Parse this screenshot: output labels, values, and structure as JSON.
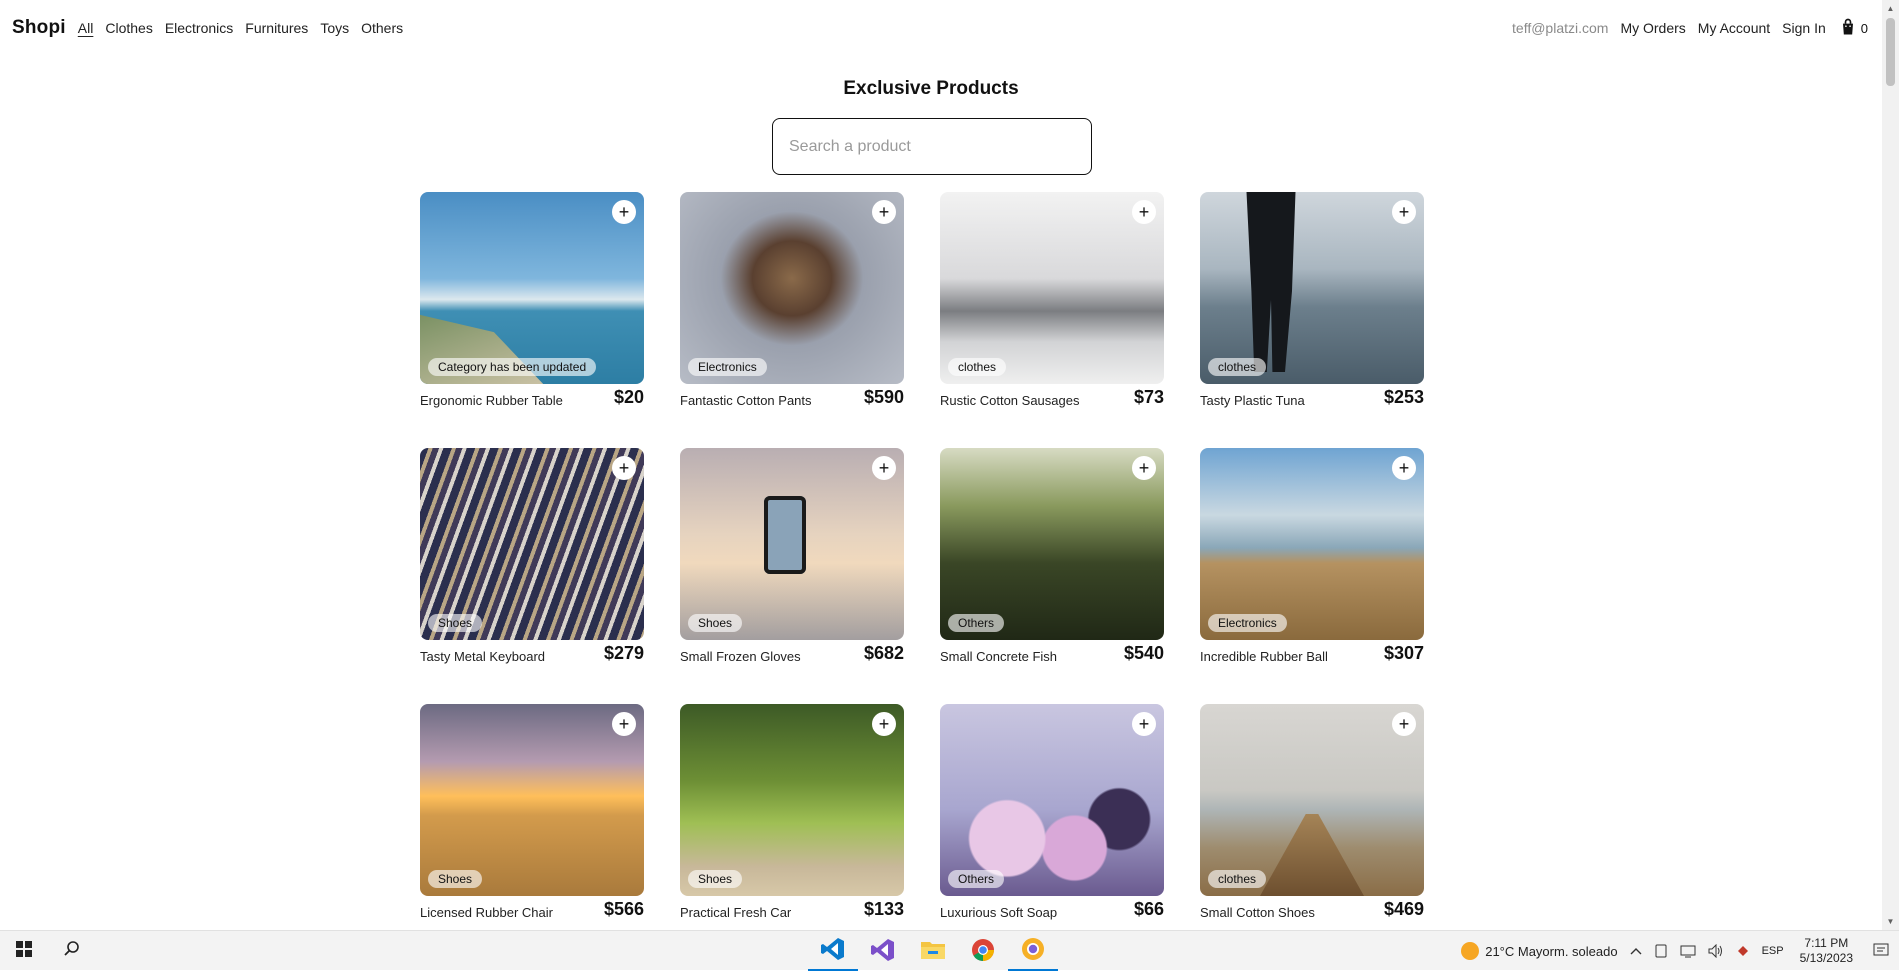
{
  "nav": {
    "brand": "Shopi",
    "categories": [
      "All",
      "Clothes",
      "Electronics",
      "Furnitures",
      "Toys",
      "Others"
    ],
    "active_category": "All",
    "email": "teff@platzi.com",
    "my_orders": "My Orders",
    "my_account": "My Account",
    "sign_in": "Sign In",
    "cart_count": "0"
  },
  "page": {
    "title": "Exclusive Products",
    "search_placeholder": "Search a product"
  },
  "products": [
    {
      "name": "Ergonomic Rubber Table",
      "price": "$20",
      "category": "Category has been updated",
      "add": "+"
    },
    {
      "name": "Fantastic Cotton Pants",
      "price": "$590",
      "category": "Electronics",
      "add": "+"
    },
    {
      "name": "Rustic Cotton Sausages",
      "price": "$73",
      "category": "clothes",
      "add": "+"
    },
    {
      "name": "Tasty Plastic Tuna",
      "price": "$253",
      "category": "clothes",
      "add": "+"
    },
    {
      "name": "Tasty Metal Keyboard",
      "price": "$279",
      "category": "Shoes",
      "add": "+"
    },
    {
      "name": "Small Frozen Gloves",
      "price": "$682",
      "category": "Shoes",
      "add": "+"
    },
    {
      "name": "Small Concrete Fish",
      "price": "$540",
      "category": "Others",
      "add": "+"
    },
    {
      "name": "Incredible Rubber Ball",
      "price": "$307",
      "category": "Electronics",
      "add": "+"
    },
    {
      "name": "Licensed Rubber Chair",
      "price": "$566",
      "category": "Shoes",
      "add": "+"
    },
    {
      "name": "Practical Fresh Car",
      "price": "$133",
      "category": "Shoes",
      "add": "+"
    },
    {
      "name": "Luxurious Soft Soap",
      "price": "$66",
      "category": "Others",
      "add": "+"
    },
    {
      "name": "Small Cotton Shoes",
      "price": "$469",
      "category": "clothes",
      "add": "+"
    }
  ],
  "taskbar": {
    "weather": "21°C  Mayorm. soleado",
    "language": "ESP",
    "time": "7:11 PM",
    "date": "5/13/2023",
    "apps": [
      "vscode-icon",
      "visual-studio-icon",
      "file-explorer-icon",
      "chrome-icon",
      "chrome-canary-icon"
    ]
  },
  "colors": {
    "accent": "#0078d4",
    "badge_bg": "#ffffffa0",
    "text": "#111111"
  }
}
